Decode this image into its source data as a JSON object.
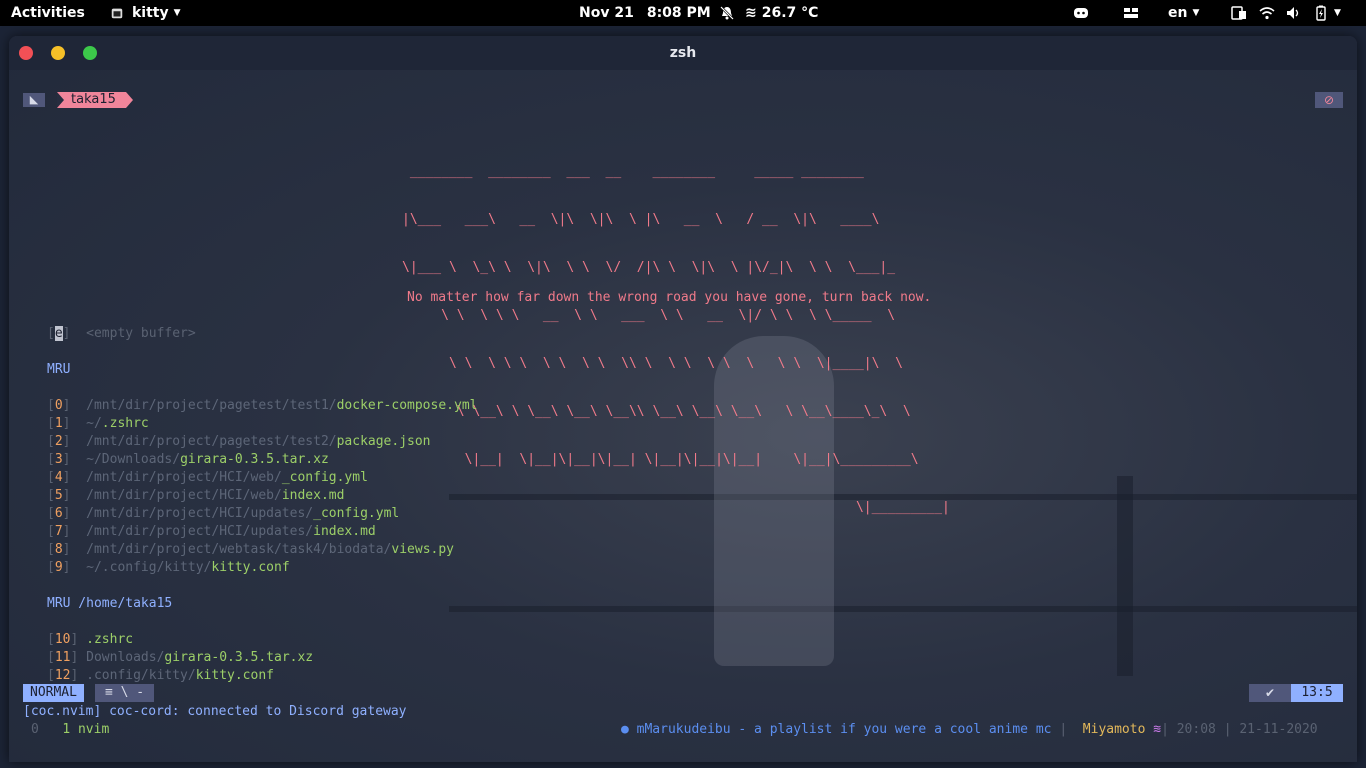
{
  "topbar": {
    "activities": "Activities",
    "app_name": "kitty",
    "date": "Nov 21",
    "time": "8:08 PM",
    "weather": "26.7 °C",
    "lang": "en"
  },
  "window": {
    "title": "zsh"
  },
  "tabline": {
    "name": "taka15"
  },
  "ascii_art": [
    " ________  ________  ___  __    ________     _____ ________",
    "|\\___   ___\\   __  \\|\\  \\|\\  \\ |\\   __  \\   / __  \\|\\   ____\\",
    "\\|___ \\  \\_\\ \\  \\|\\  \\ \\  \\/  /|\\ \\  \\|\\  \\ |\\/_|\\  \\ \\  \\___|_",
    "     \\ \\  \\ \\ \\   __  \\ \\   ___  \\ \\   __  \\|/ \\ \\  \\ \\_____  \\",
    "      \\ \\  \\ \\ \\  \\ \\  \\ \\  \\\\ \\  \\ \\  \\ \\  \\   \\ \\  \\|____|\\  \\",
    "       \\ \\__\\ \\ \\__\\ \\__\\ \\__\\\\ \\__\\ \\__\\ \\__\\   \\ \\__\\____\\_\\  \\",
    "        \\|__|  \\|__|\\|__|\\|__| \\|__|\\|__|\\|__|    \\|__|\\_________\\",
    "                                                          \\|_________|"
  ],
  "quote": "No matter how far down the wrong road you have gone, turn back now.",
  "buffer": {
    "key": "e",
    "label": "<empty buffer>"
  },
  "mru_title": "MRU",
  "mru": [
    {
      "idx": "0",
      "dir": "/mnt/dir/project/pagetest/test1/",
      "file": "docker-compose.yml"
    },
    {
      "idx": "1",
      "dir": "~/",
      "file": ".zshrc"
    },
    {
      "idx": "2",
      "dir": "/mnt/dir/project/pagetest/test2/",
      "file": "package.json"
    },
    {
      "idx": "3",
      "dir": "~/Downloads/",
      "file": "girara-0.3.5.tar.xz"
    },
    {
      "idx": "4",
      "dir": "/mnt/dir/project/HCI/web/",
      "file": "_config.yml"
    },
    {
      "idx": "5",
      "dir": "/mnt/dir/project/HCI/web/",
      "file": "index.md"
    },
    {
      "idx": "6",
      "dir": "/mnt/dir/project/HCI/updates/",
      "file": "_config.yml"
    },
    {
      "idx": "7",
      "dir": "/mnt/dir/project/HCI/updates/",
      "file": "index.md"
    },
    {
      "idx": "8",
      "dir": "/mnt/dir/project/webtask/task4/biodata/",
      "file": "views.py"
    },
    {
      "idx": "9",
      "dir": "~/.config/kitty/",
      "file": "kitty.conf"
    }
  ],
  "mru_home_title": "MRU /home/taka15",
  "mru_home": [
    {
      "idx": "10",
      "dir": "",
      "file": ".zshrc"
    },
    {
      "idx": "11",
      "dir": "Downloads/",
      "file": "girara-0.3.5.tar.xz"
    },
    {
      "idx": "12",
      "dir": ".config/kitty/",
      "file": "kitty.conf"
    }
  ],
  "statusline": {
    "mode": "NORMAL",
    "mid": "≡  \\  -",
    "position": "13:5"
  },
  "message": "[coc.nvim] coc-cord: connected to Discord gateway",
  "tmux": {
    "session": "0",
    "window": "1 nvim",
    "music": "mMarukudeibu - a playlist if you were a cool anime mc",
    "user": "Miyamoto",
    "time": "20:08",
    "date": "21-11-2020"
  },
  "colors": {
    "accent_pink": "#f0859a",
    "accent_blue": "#8fb0ff",
    "path_green": "#9ccf68",
    "index_orange": "#f0a060"
  }
}
